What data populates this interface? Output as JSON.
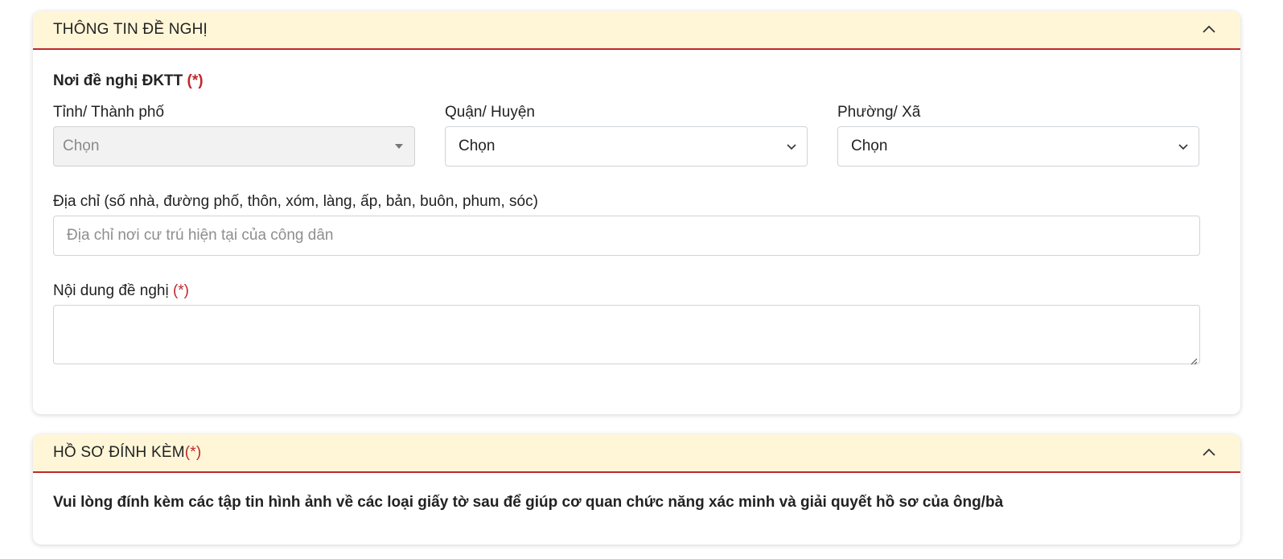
{
  "proposal_section": {
    "title": "THÔNG TIN ĐỀ NGHỊ",
    "location_heading": "Nơi đề nghị ĐKTT ",
    "required_mark": "(*)",
    "province": {
      "label": "Tỉnh/ Thành phố",
      "value": "Chọn"
    },
    "district": {
      "label": "Quận/ Huyện",
      "value": "Chọn"
    },
    "ward": {
      "label": "Phường/ Xã",
      "value": "Chọn"
    },
    "address": {
      "label": "Địa chỉ (số nhà, đường phố, thôn, xóm, làng, ấp, bản, buôn, phum, sóc)",
      "placeholder": "Địa chỉ nơi cư trú hiện tại của công dân",
      "value": ""
    },
    "content": {
      "label": "Nội dung đề nghị ",
      "required_mark": "(*)",
      "value": ""
    }
  },
  "attachments_section": {
    "title": "HỒ SƠ ĐÍNH KÈM",
    "required_mark": "(*)",
    "note": "Vui lòng đính kèm các tập tin hình ảnh về các loại giấy tờ sau để giúp cơ quan chức năng xác minh và giải quyết hồ sơ của ông/bà"
  },
  "colors": {
    "header_bg": "#fff6d8",
    "accent_red": "#c0272d",
    "disabled_bg": "#f2f2f2"
  },
  "icons": {
    "collapse": "chevron-up-icon",
    "select_disabled": "caret-down-icon",
    "select_active": "chevron-down-icon"
  }
}
